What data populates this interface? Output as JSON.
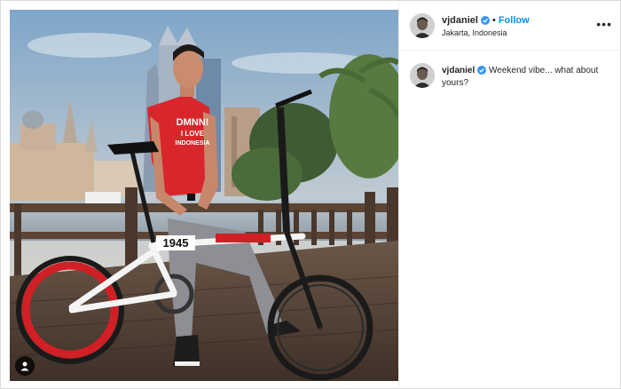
{
  "post": {
    "username": "vjdaniel",
    "separator": "•",
    "follow_label": "Follow",
    "location": "Jakarta, Indonesia",
    "more_icon": "more-horizontal-icon",
    "more_label": "•••"
  },
  "caption": {
    "username": "vjdaniel",
    "text": "Weekend vibe... what about yours?"
  },
  "photo": {
    "shirt_text_line1": "DMNN!",
    "shirt_text_line2": "I LOVE",
    "shirt_text_line3": "INDONESIA",
    "bike_frame_number": "1945"
  },
  "colors": {
    "accent": "#0095f6",
    "verified": "#3897f0"
  }
}
